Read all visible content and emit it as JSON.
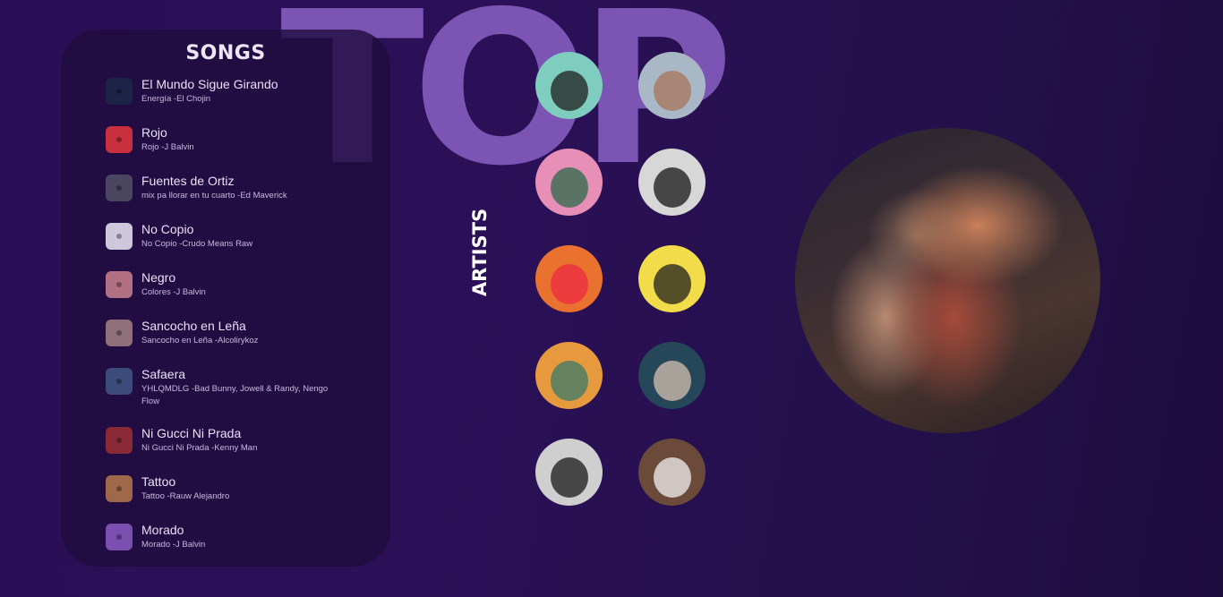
{
  "hero_word": "TOP",
  "songs": {
    "title": "SONGS",
    "items": [
      {
        "title": "El Mundo Sigue Girando",
        "subtitle": "Energía -El Chojin",
        "thumb_color": "#1d2347"
      },
      {
        "title": "Rojo",
        "subtitle": "Rojo -J Balvin",
        "thumb_color": "#c9303d"
      },
      {
        "title": "Fuentes de Ortiz",
        "subtitle": "mix pa llorar en tu cuarto -Ed Maverick",
        "thumb_color": "#4b4660"
      },
      {
        "title": "No Copio",
        "subtitle": "No Copio -Crudo Means Raw",
        "thumb_color": "#cfc7db"
      },
      {
        "title": "Negro",
        "subtitle": "Colores -J Balvin",
        "thumb_color": "#b27084"
      },
      {
        "title": "Sancocho en Leña",
        "subtitle": "Sancocho en Leña -Alcolirykoz",
        "thumb_color": "#8e6f7a"
      },
      {
        "title": "Safaera",
        "subtitle": "YHLQMDLG -Bad Bunny, Jowell & Randy, Nengo Flow",
        "thumb_color": "#3c4c7a"
      },
      {
        "title": "Ni Gucci Ni Prada",
        "subtitle": "Ni Gucci Ni Prada -Kenny Man",
        "thumb_color": "#8a2a36"
      },
      {
        "title": "Tattoo",
        "subtitle": "Tattoo -Rauw Alejandro",
        "thumb_color": "#a0684a"
      },
      {
        "title": "Morado",
        "subtitle": "Morado -J Balvin",
        "thumb_color": "#7b4fb0"
      }
    ]
  },
  "artists": {
    "label": "ARTISTS",
    "items": [
      {
        "name": "artist-1",
        "bg": "#7fcdbf",
        "accent": "#1d1d1d"
      },
      {
        "name": "artist-2",
        "bg": "#a9b8c7",
        "accent": "#a87559"
      },
      {
        "name": "artist-3",
        "bg": "#e88fb8",
        "accent": "#2a6a4a"
      },
      {
        "name": "artist-4",
        "bg": "#d7d7d7",
        "accent": "#151515"
      },
      {
        "name": "artist-5",
        "bg": "#e8722e",
        "accent": "#ef2a44"
      },
      {
        "name": "artist-6",
        "bg": "#f2dc4a",
        "accent": "#1f1f1f"
      },
      {
        "name": "artist-7",
        "bg": "#e79a3d",
        "accent": "#3a7a6b"
      },
      {
        "name": "artist-8",
        "bg": "#26465a",
        "accent": "#d6c2b0"
      },
      {
        "name": "artist-9",
        "bg": "#cfcfcf",
        "accent": "#1a1a1a"
      },
      {
        "name": "artist-10",
        "bg": "#6b4a3a",
        "accent": "#f2f2f2"
      }
    ]
  }
}
